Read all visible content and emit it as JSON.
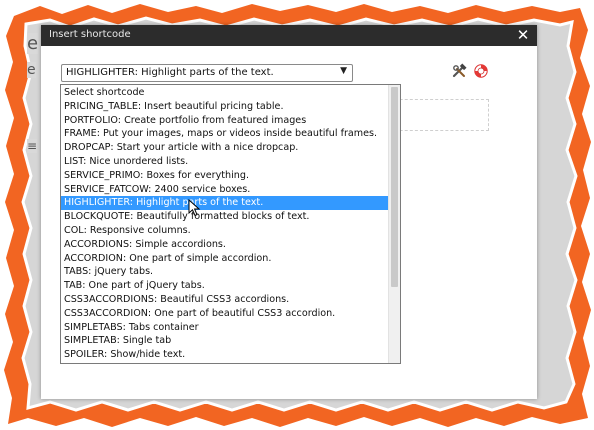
{
  "dialog": {
    "title": "Insert shortcode",
    "close_label": "✕"
  },
  "select": {
    "value": "HIGHLIGHTER:  Highlight parts of the text.",
    "arrow": "▼"
  },
  "icons": {
    "tools": "tools-icon",
    "help": "lifebuoy-icon"
  },
  "dropdown": {
    "selected_index": 10,
    "options": [
      "Select shortcode",
      "PRICING_TABLE:  Insert beautiful pricing table.",
      "PORTFOLIO:  Create portfolio from featured images",
      "FRAME:  Put your images, maps or videos inside beautiful frames.",
      "DROPCAP:  Start your article with a nice dropcap.",
      "LIST:  Nice unordered lists.",
      "SERVICE_PRIMO:  Boxes for everything.",
      "SERVICE_FATCOW:  2400 service boxes.",
      "HIGHLIGHTER:  Highlight parts of the text.",
      "BLOCKQUOTE:  Beautifully formatted blocks of text.",
      "COL:  Responsive columns.",
      "ACCORDIONS:  Simple accordions.",
      "ACCORDION:  One part of simple accordion.",
      "TABS:  jQuery tabs.",
      "TAB:  One part of jQuery tabs.",
      "CSS3ACCORDIONS:  Beautiful CSS3 accordions.",
      "CSS3ACCORDION:  One part of beautiful CSS3 accordion.",
      "SIMPLETABS:  Tabs container",
      "SIMPLETAB:  Single tab",
      "SPOILER:  Show/hide text."
    ]
  },
  "background": {
    "letter_top": "e",
    "letter_mid": "e",
    "menu_glyph": "≡"
  },
  "colors": {
    "frame_orange": "#f26522",
    "selection_blue": "#3399ff",
    "titlebar": "#2c2c2c"
  }
}
